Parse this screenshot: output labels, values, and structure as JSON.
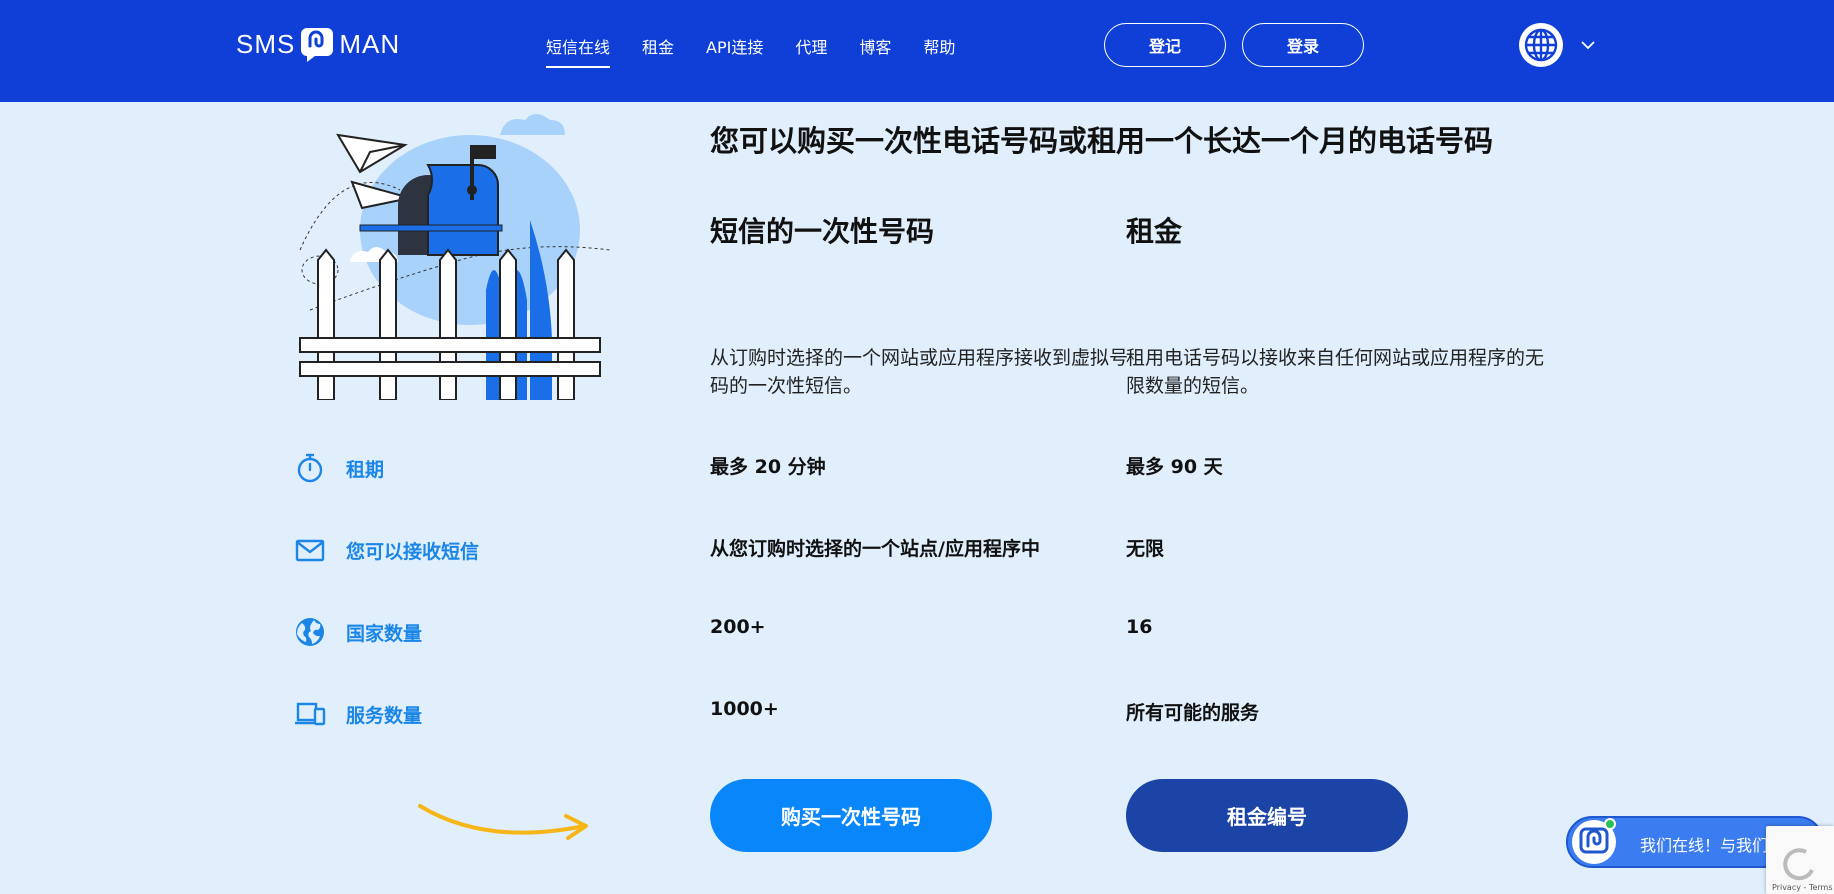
{
  "brand": {
    "logo_left": "SMS",
    "logo_right": "MAN"
  },
  "nav": {
    "items": [
      {
        "label": "短信在线",
        "active": true
      },
      {
        "label": "租金"
      },
      {
        "label": "API连接"
      },
      {
        "label": "代理"
      },
      {
        "label": "博客"
      },
      {
        "label": "帮助"
      }
    ]
  },
  "auth": {
    "register_label": "登记",
    "login_label": "登录"
  },
  "main": {
    "headline": "您可以购买一次性电话号码或租用一个长达一个月的电话号码",
    "columns": [
      {
        "title": "短信的一次性号码",
        "description": "从订购时选择的一个网站或应用程序接收到虚拟号码的一次性短信。"
      },
      {
        "title": "租金",
        "description": "租用电话号码以接收来自任何网站或应用程序的无限数量的短信。"
      }
    ],
    "rows": [
      {
        "label": "租期",
        "a": "最多 20 分钟",
        "b": "最多 90 天"
      },
      {
        "label": "您可以接收短信",
        "a": "从您订购时选择的一个站点/应用程序中",
        "b": "无限"
      },
      {
        "label": "国家数量",
        "a": "200+",
        "b": "16"
      },
      {
        "label": "服务数量",
        "a": "1000+",
        "b": "所有可能的服务"
      }
    ],
    "cta_buy": "购买一次性号码",
    "cta_rent": "租金编号"
  },
  "chat": {
    "label": "我们在线！与我们聊天"
  },
  "recaptcha": {
    "text": "Privacy - Terms"
  },
  "colors": {
    "header": "#0f3fd6",
    "background": "#e1effd",
    "accent": "#1b86e8",
    "cta_buy": "#0a86fb",
    "cta_rent": "#1c44a6"
  }
}
